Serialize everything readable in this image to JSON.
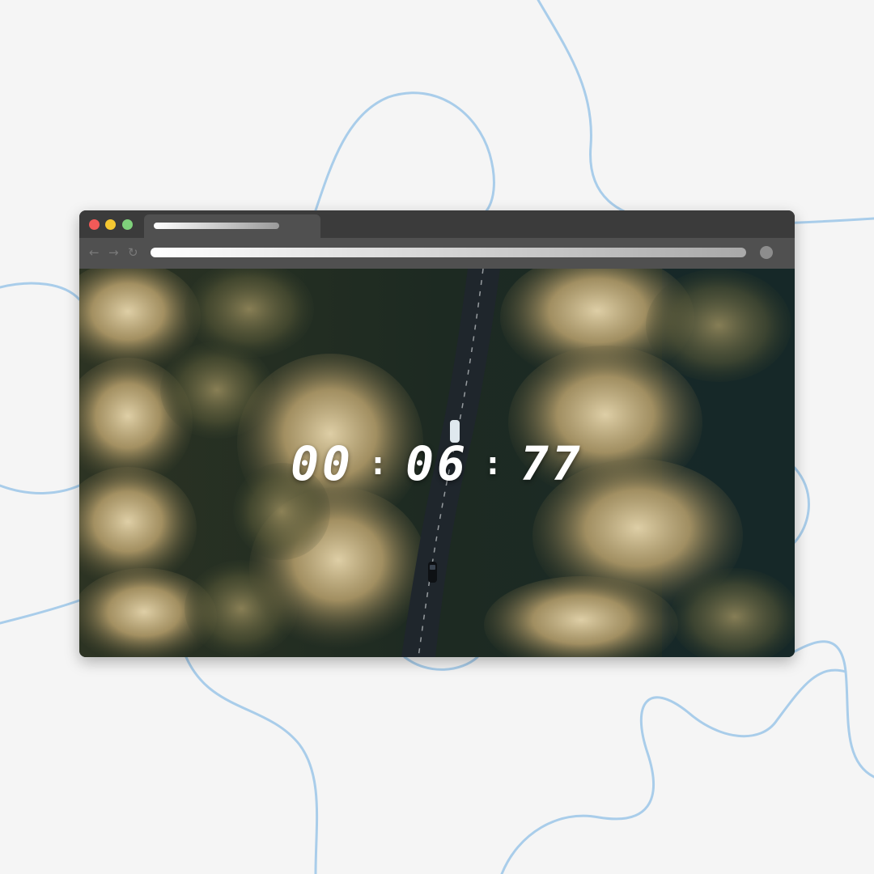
{
  "colors": {
    "page_background": "#f5f5f5",
    "decorative_lines": "#a9cdea",
    "window_frame": "#3b3b3b",
    "toolbar": "#505050",
    "close_dot": "#f25a58",
    "minimize_dot": "#f5c831",
    "maximize_dot": "#7fd17b",
    "timer_text": "#ffffff"
  },
  "browser": {
    "nav_icons": {
      "back": "←",
      "forward": "→",
      "reload": "↻"
    },
    "menu_icon": "circle-icon"
  },
  "timer": {
    "minutes": "00",
    "seconds": "06",
    "hundredths": "77",
    "separator": ":"
  },
  "background_image": "aerial view of a road through an autumn forest with a car"
}
